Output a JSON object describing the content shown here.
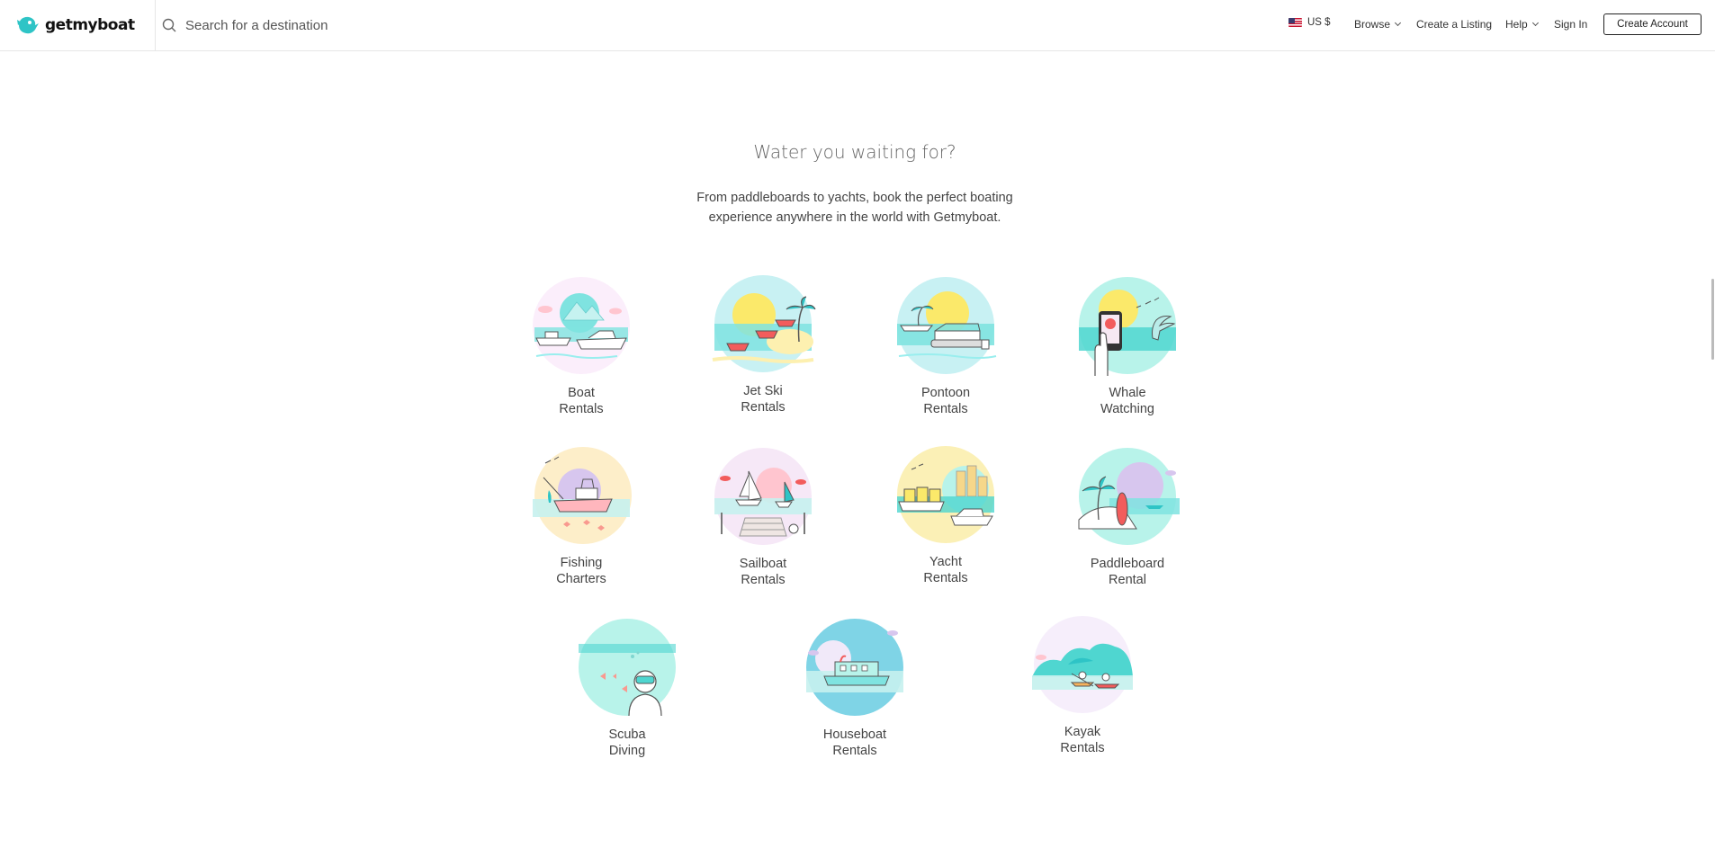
{
  "header": {
    "logo_text": "getmyboat",
    "search_placeholder": "Search for a destination",
    "currency": "US $",
    "browse": "Browse",
    "create_listing": "Create a Listing",
    "help": "Help",
    "sign_in": "Sign In",
    "create_account": "Create Account"
  },
  "hero": {
    "title": "Water you waiting for?",
    "subtitle": "From paddleboards to yachts, book the perfect boating experience anywhere in the world with Getmyboat."
  },
  "categories": [
    {
      "line1": "Boat",
      "line2": "Rentals",
      "icon": "boat-rentals-icon"
    },
    {
      "line1": "Jet Ski",
      "line2": "Rentals",
      "icon": "jet-ski-icon"
    },
    {
      "line1": "Pontoon",
      "line2": "Rentals",
      "icon": "pontoon-icon"
    },
    {
      "line1": "Whale",
      "line2": "Watching",
      "icon": "whale-icon"
    },
    {
      "line1": "Fishing",
      "line2": "Charters",
      "icon": "fishing-icon"
    },
    {
      "line1": "Sailboat",
      "line2": "Rentals",
      "icon": "sailboat-icon"
    },
    {
      "line1": "Yacht",
      "line2": "Rentals",
      "icon": "yacht-icon"
    },
    {
      "line1": "Paddleboard",
      "line2": "Rental",
      "icon": "paddleboard-icon"
    },
    {
      "line1": "Scuba",
      "line2": "Diving",
      "icon": "scuba-icon"
    },
    {
      "line1": "Houseboat",
      "line2": "Rentals",
      "icon": "houseboat-icon"
    },
    {
      "line1": "Kayak",
      "line2": "Rentals",
      "icon": "kayak-icon"
    }
  ],
  "colors": {
    "brand": "#2ec4c6",
    "water": "#7fe3e0",
    "sun": "#fbe96a",
    "pink": "#ffc5cf",
    "lavender": "#d7c6ee"
  }
}
